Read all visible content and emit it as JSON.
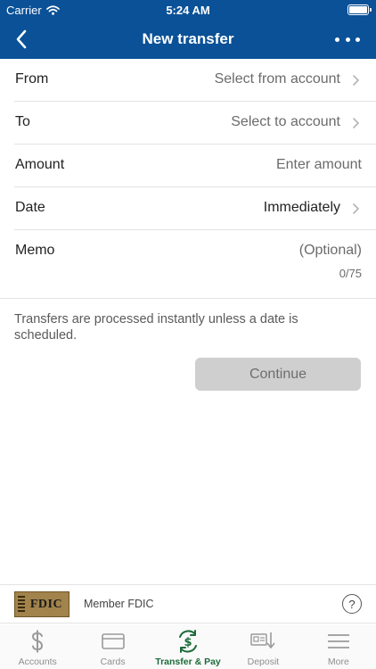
{
  "status_bar": {
    "carrier": "Carrier",
    "time": "5:24 AM"
  },
  "nav": {
    "title": "New transfer",
    "back_icon": "chevron-left-icon",
    "more_icon": "more-dots-icon"
  },
  "form": {
    "from": {
      "label": "From",
      "value": "Select from account"
    },
    "to": {
      "label": "To",
      "value": "Select to account"
    },
    "amount": {
      "label": "Amount",
      "placeholder": "Enter amount"
    },
    "date": {
      "label": "Date",
      "value": "Immediately"
    },
    "memo": {
      "label": "Memo",
      "placeholder": "(Optional)",
      "counter": "0/75"
    }
  },
  "note": "Transfers are processed instantly unless a date is scheduled.",
  "continue_label": "Continue",
  "fdic": {
    "logo_text": "FDIC",
    "member_text": "Member FDIC",
    "help_label": "?"
  },
  "tabs": [
    {
      "label": "Accounts",
      "icon": "dollar-icon",
      "active": false
    },
    {
      "label": "Cards",
      "icon": "card-icon",
      "active": false
    },
    {
      "label": "Transfer & Pay",
      "icon": "transfer-icon",
      "active": true
    },
    {
      "label": "Deposit",
      "icon": "deposit-icon",
      "active": false
    },
    {
      "label": "More",
      "icon": "menu-icon",
      "active": false
    }
  ],
  "colors": {
    "header": "#0a5197",
    "active_tab": "#1d6b3a",
    "button_disabled": "#cfcfcf"
  }
}
